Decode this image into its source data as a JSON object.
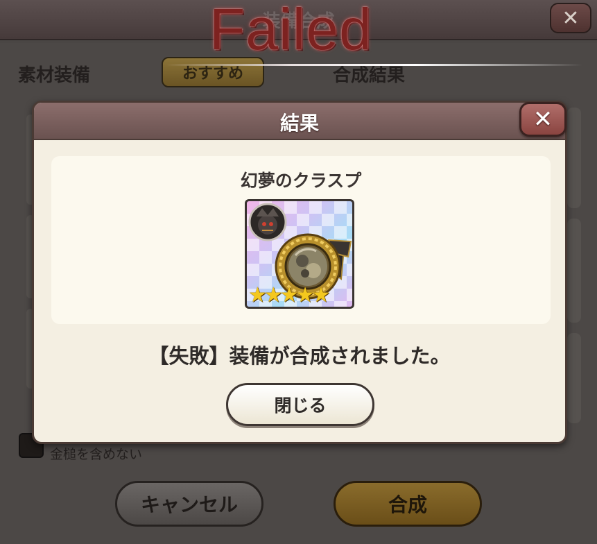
{
  "background": {
    "header_title": "装備合成",
    "close_glyph": "✕",
    "material_label": "素材装備",
    "recommend_label": "おすすめ",
    "result_label": "合成結果",
    "checkbox_label": "金槌を含めない",
    "cancel_label": "キャンセル",
    "synthesize_label": "合成"
  },
  "overlay": {
    "failed_text": "Failed"
  },
  "dialog": {
    "title": "結果",
    "close_glyph": "✕",
    "item_name": "幻夢のクラスプ",
    "item_rarity_stars": 5,
    "item_icon": "clasp-medallion-icon",
    "stars_text": "★★★★★",
    "message": "【失敗】装備が合成されました。",
    "close_button_label": "閉じる"
  },
  "colors": {
    "failed_red": "#7d2220",
    "dialog_header": "#7a5e5c",
    "dialog_body": "#f4efe2",
    "close_accent": "#9c5652",
    "star_gold": "#f4c81e"
  }
}
